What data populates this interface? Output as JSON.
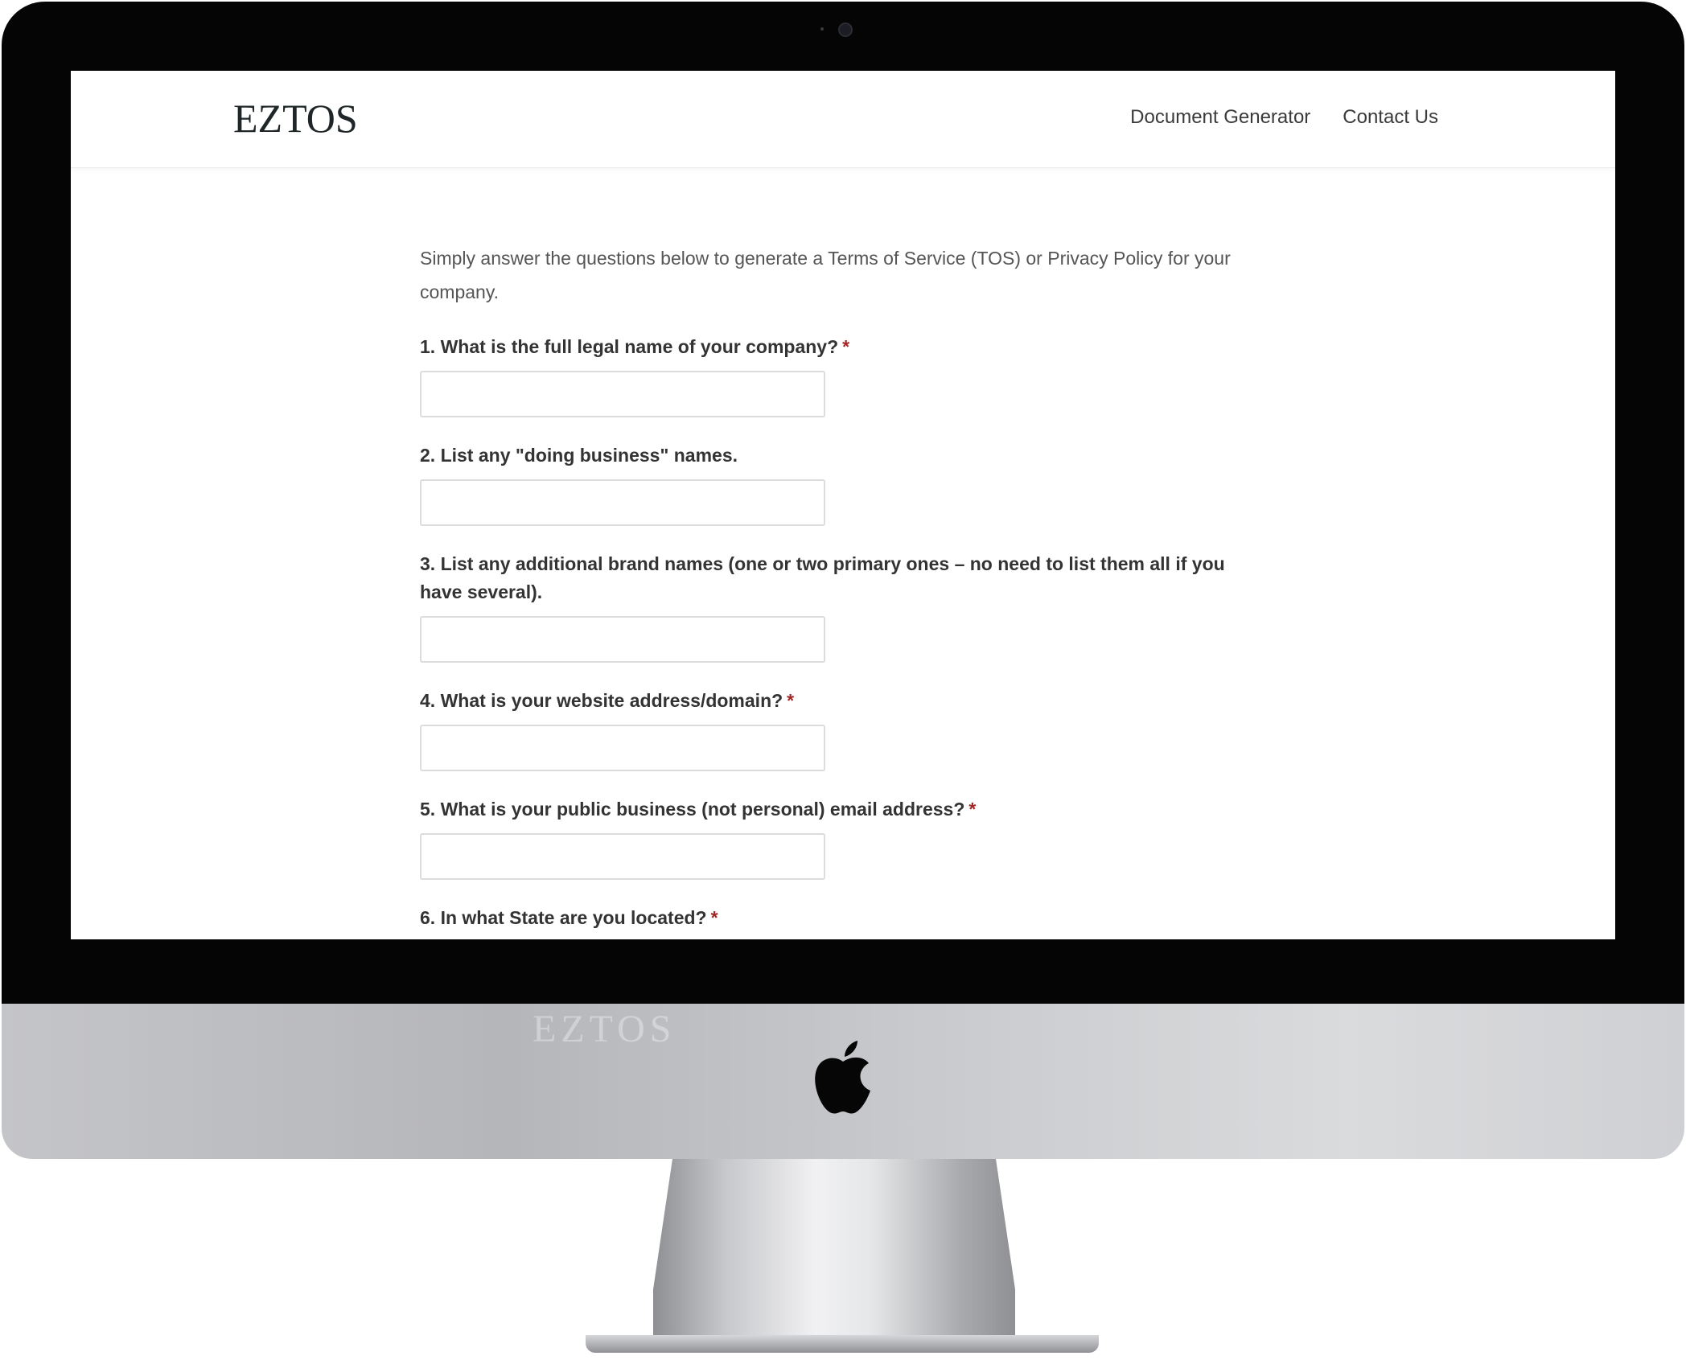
{
  "site": {
    "logo": "EZTOS",
    "nav": {
      "document_generator": "Document Generator",
      "contact_us": "Contact Us"
    }
  },
  "form": {
    "intro": "Simply answer the questions below to generate a Terms of Service (TOS) or Privacy Policy for your company.",
    "required_marker": "*",
    "questions": [
      {
        "label": "1. What is the full legal name of your company?",
        "required": true,
        "value": ""
      },
      {
        "label": "2. List any \"doing business\" names.",
        "required": false,
        "value": ""
      },
      {
        "label": "3. List any additional brand names (one or two primary ones – no need to list them all if you have several).",
        "required": false,
        "value": ""
      },
      {
        "label": "4. What is your website address/domain?",
        "required": true,
        "value": ""
      },
      {
        "label": "5. What is your public business (not personal) email address?",
        "required": true,
        "value": ""
      },
      {
        "label": "6. In what State are you located?",
        "required": true
      }
    ]
  },
  "device": {
    "chin_reflection": "EZTOS"
  },
  "icons": {
    "device_logo": "apple-logo-icon",
    "camera": "camera-icon"
  },
  "colors": {
    "bezel": "#050505",
    "required": "#a32626",
    "text": "#333333"
  }
}
